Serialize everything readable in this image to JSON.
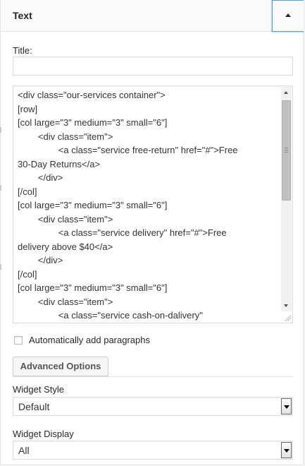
{
  "widget": {
    "title": "Text",
    "toggle_icon": "arrow-up-icon"
  },
  "form": {
    "title_label": "Title:",
    "title_value": "",
    "content_lines": [
      "<div class=\"our-services container\">",
      "[row]",
      "[col large=\"3\" medium=\"3\" small=\"6\"]",
      "        <div class=\"item\">",
      "                <a class=\"service free-return\" href=\"#\">Free",
      "30-Day Returns</a>",
      "        </div>",
      "[/col]",
      "[col large=\"3\" medium=\"3\" small=\"6\"]",
      "        <div class=\"item\">",
      "                <a class=\"service delivery\" href=\"#\">Free",
      "delivery above $40</a>",
      "        </div>",
      "[/col]",
      "[col large=\"3\" medium=\"3\" small=\"6\"]",
      "        <div class=\"item\">",
      "                <a class=\"service cash-on-dalivery\""
    ],
    "auto_paragraphs_label": "Automatically add paragraphs",
    "auto_paragraphs_checked": false,
    "advanced_options_label": "Advanced Options",
    "widget_style_label": "Widget Style",
    "widget_style_value": "Default",
    "widget_display_label": "Widget Display",
    "widget_display_value": "All"
  }
}
